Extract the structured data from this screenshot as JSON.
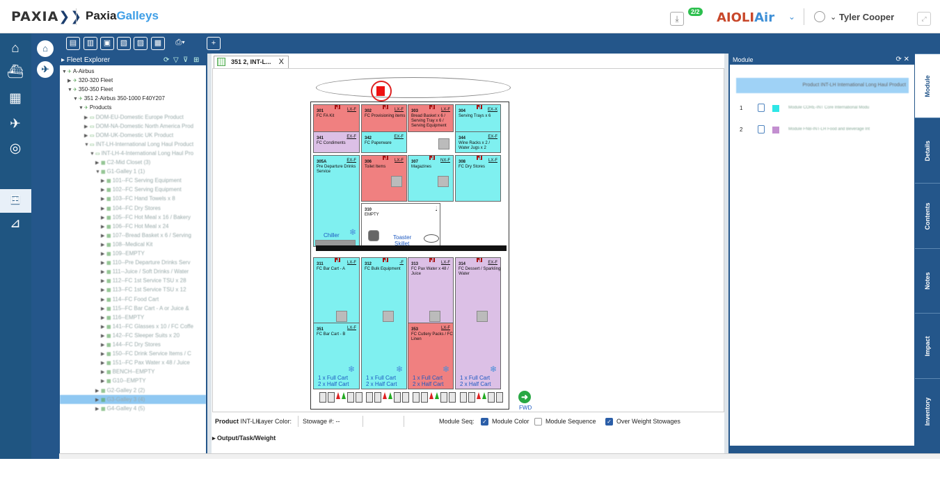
{
  "header": {
    "logo_text": "PAXIA",
    "logo_chev": "❯❯",
    "app_name_a": "Paxia",
    "app_name_b": "Galleys",
    "download_badge": "2/2",
    "airline_a": "AIOLI",
    "airline_b": "Air",
    "user_name": "Tyler Cooper"
  },
  "toolbar": {
    "icons": [
      "galley-icon",
      "galley-edit-icon",
      "galley-copy-icon",
      "galley-compare-icon",
      "galley-layers-icon",
      "calendar-icon",
      "print-icon",
      "add-icon"
    ]
  },
  "fleet": {
    "title": "Fleet Explorer",
    "nodes": [
      {
        "label": "A-Airbus",
        "level": 0,
        "arrow": "▼",
        "blur": false
      },
      {
        "label": "320-320 Fleet",
        "level": 1,
        "arrow": "▶",
        "blur": false
      },
      {
        "label": "350-350 Fleet",
        "level": 1,
        "arrow": "▼",
        "blur": false
      },
      {
        "label": "351 2-Airbus 350-1000 F40Y207",
        "level": 2,
        "arrow": "▼",
        "blur": false
      },
      {
        "label": "Products",
        "level": 3,
        "arrow": "▼",
        "blur": false
      },
      {
        "label": "DOM-EU-Domestic Europe Product",
        "level": 4,
        "arrow": "▶",
        "blur": true
      },
      {
        "label": "DOM-NA-Domestic North America Prod",
        "level": 4,
        "arrow": "▶",
        "blur": true
      },
      {
        "label": "DOM-UK-Domestic UK Product",
        "level": 4,
        "arrow": "▶",
        "blur": true
      },
      {
        "label": "INT-LH-International Long Haul Product",
        "level": 4,
        "arrow": "▼",
        "blur": true
      },
      {
        "label": "INT-LH-4-International Long Haul Pro",
        "level": 5,
        "arrow": "▼",
        "blur": true
      },
      {
        "label": "C2-Mid Closet (3)",
        "level": 6,
        "arrow": "▶",
        "blur": true
      },
      {
        "label": "G1-Galley 1 (1)",
        "level": 6,
        "arrow": "▼",
        "blur": true
      },
      {
        "label": "101--FC Serving Equipment",
        "level": 7,
        "arrow": "▶",
        "blur": true
      },
      {
        "label": "102--FC Serving Equipment",
        "level": 7,
        "arrow": "▶",
        "blur": true
      },
      {
        "label": "103--FC Hand Towels x 8",
        "level": 7,
        "arrow": "▶",
        "blur": true
      },
      {
        "label": "104--FC Dry Stores",
        "level": 7,
        "arrow": "▶",
        "blur": true
      },
      {
        "label": "105--FC Hot Meal x 16 / Bakery",
        "level": 7,
        "arrow": "▶",
        "blur": true
      },
      {
        "label": "106--FC Hot Meal x 24",
        "level": 7,
        "arrow": "▶",
        "blur": true
      },
      {
        "label": "107--Bread Basket x 6 / Serving",
        "level": 7,
        "arrow": "▶",
        "blur": true
      },
      {
        "label": "108--Medical Kit",
        "level": 7,
        "arrow": "▶",
        "blur": true
      },
      {
        "label": "109--EMPTY",
        "level": 7,
        "arrow": "▶",
        "blur": true
      },
      {
        "label": "110--Pre Departure Drinks Serv",
        "level": 7,
        "arrow": "▶",
        "blur": true
      },
      {
        "label": "111--Juice / Soft Drinks / Water",
        "level": 7,
        "arrow": "▶",
        "blur": true
      },
      {
        "label": "112--FC 1st Service TSU x 28",
        "level": 7,
        "arrow": "▶",
        "blur": true
      },
      {
        "label": "113--FC 1st Service TSU x 12",
        "level": 7,
        "arrow": "▶",
        "blur": true
      },
      {
        "label": "114--FC Food Cart",
        "level": 7,
        "arrow": "▶",
        "blur": true
      },
      {
        "label": "115--FC Bar Cart - A or Juice &",
        "level": 7,
        "arrow": "▶",
        "blur": true
      },
      {
        "label": "116--EMPTY",
        "level": 7,
        "arrow": "▶",
        "blur": true
      },
      {
        "label": "141--FC Glasses x 10 / FC Coffe",
        "level": 7,
        "arrow": "▶",
        "blur": true
      },
      {
        "label": "142--FC Sleeper Suits x 20",
        "level": 7,
        "arrow": "▶",
        "blur": true
      },
      {
        "label": "144--FC Dry Stores",
        "level": 7,
        "arrow": "▶",
        "blur": true
      },
      {
        "label": "150--FC Drink Service Items / C",
        "level": 7,
        "arrow": "▶",
        "blur": true
      },
      {
        "label": "151--FC Pax Water x 48 / Juice",
        "level": 7,
        "arrow": "▶",
        "blur": true
      },
      {
        "label": "BENCH--EMPTY",
        "level": 7,
        "arrow": "▶",
        "blur": true
      },
      {
        "label": "G10--EMPTY",
        "level": 7,
        "arrow": "▶",
        "blur": true
      },
      {
        "label": "G2-Galley 2 (2)",
        "level": 6,
        "arrow": "▶",
        "blur": true
      },
      {
        "label": "G3-Galley 3 (4)",
        "level": 6,
        "arrow": "▶",
        "blur": true,
        "selected": true
      },
      {
        "label": "G4-Galley 4 (5)",
        "level": 6,
        "arrow": "▶",
        "blur": true
      }
    ]
  },
  "tab": {
    "label": "351 2, INT-L...",
    "close": "X"
  },
  "galley": {
    "cells": [
      {
        "num": "301",
        "code": "LX-F",
        "text": "FC FA Kit",
        "color": "#f08080"
      },
      {
        "num": "302",
        "code": "LX-F",
        "text": "FC Provisioning items",
        "color": "#f08080"
      },
      {
        "num": "303",
        "code": "LX-F",
        "text": "Bread Basket x 6 / Serving Tray x 6 / Serving Equipment",
        "color": "#f08080"
      },
      {
        "num": "304",
        "code": "EX-X",
        "text": "Serving Trays x 6",
        "color": "#7ff0f0"
      },
      {
        "num": "341",
        "code": "EX-F",
        "text": "FC Condiments",
        "color": "#dcc0e6"
      },
      {
        "num": "342",
        "code": "EX-F",
        "text": "FC Paperware",
        "color": "#7ff0f0"
      },
      {
        "num": "344",
        "code": "EX-F",
        "text": "Wine Racks x 2 / Water Jugs x 2",
        "color": "#7ff0f0"
      },
      {
        "num": "305A",
        "code": "EX-F",
        "text": "Pre Departure Drinks Service",
        "color": "#7ff0f0"
      },
      {
        "num": "306",
        "code": "LX-F",
        "text": "Toilet Items",
        "color": "#f08080"
      },
      {
        "num": "307",
        "code": "NX-F",
        "text": "Magazines",
        "color": "#7ff0f0"
      },
      {
        "num": "308",
        "code": "LX-F",
        "text": "FC Dry Stores",
        "color": "#7ff0f0"
      },
      {
        "num": "310",
        "code": ":",
        "text": "EMPTY",
        "color": "#ffffff"
      },
      {
        "num": "311",
        "code": "LX-F",
        "text": "FC Bar Cart - A",
        "color": "#7ff0f0"
      },
      {
        "num": "312",
        "code": "-F",
        "text": "FC Bulk Equipment",
        "color": "#7ff0f0"
      },
      {
        "num": "313",
        "code": "LX-F",
        "text": "FC Pax Water x 48 / Juice",
        "color": "#dcc0e6"
      },
      {
        "num": "314",
        "code": "EX-F",
        "text": "FC Dessert / Sparkling Water",
        "color": "#dcc0e6"
      },
      {
        "num": "351",
        "code": "LX-F",
        "text": "FC Bar Cart - B",
        "color": "#7ff0f0"
      },
      {
        "num": "353",
        "code": "LX-F",
        "text": "FC Cutlery Packs / FC Linen",
        "color": "#f08080"
      }
    ],
    "chiller": "Chiller",
    "toaster": "Toaster",
    "skillet": "Skillet",
    "cart_full": "1 x Full Cart",
    "cart_half": "2 x Half Cart",
    "fwd": "FWD"
  },
  "status": {
    "product_label": "Product",
    "product_value": "INT-LH",
    "layer_color": "Layer Color:",
    "stowage": "Stowage #:  --",
    "module_seq": "Module Seq:",
    "module_color": "Module Color",
    "module_sequence": "Module Sequence",
    "over_weight": "Over Weight Stowages",
    "output": "Output/Task/Weight"
  },
  "module": {
    "title": "Module",
    "product": "Product INT-LH International Long Haul Product",
    "rows": [
      {
        "n": "1",
        "color": "#2ee6e6",
        "text": "Module CORE-INT Core International Modu"
      },
      {
        "n": "2",
        "color": "#c38fd0",
        "text": "Module FNB-INT-LH Food and Beverage Int"
      }
    ]
  },
  "right_tabs": [
    "Module",
    "Details",
    "Contents",
    "Notes",
    "Impact",
    "Inventory"
  ]
}
